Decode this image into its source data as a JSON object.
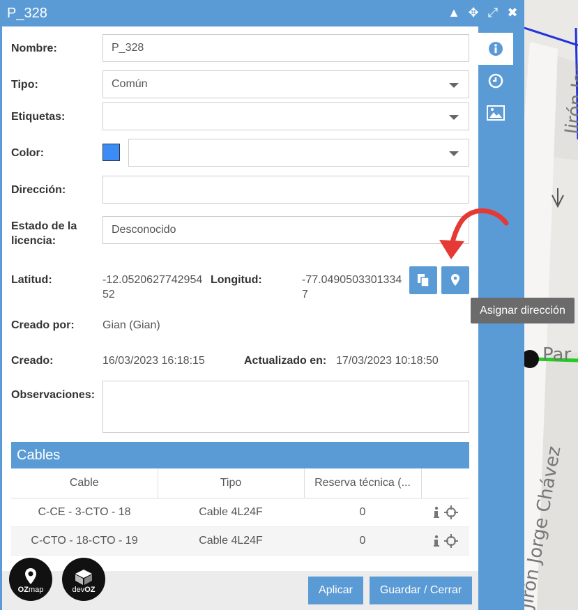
{
  "window": {
    "title": "P_328"
  },
  "form": {
    "nombre_label": "Nombre:",
    "nombre_value": "P_328",
    "tipo_label": "Tipo:",
    "tipo_value": "Común",
    "etiquetas_label": "Etiquetas:",
    "etiquetas_value": "",
    "color_label": "Color:",
    "color_value": "#3b8cf7",
    "direccion_label": "Dirección:",
    "direccion_value": "",
    "estado_label_1": "Estado de la",
    "estado_label_2": "licencia:",
    "estado_value": "Desconocido",
    "latitud_label": "Latitud:",
    "latitud_value_1": "-12.0520627742954",
    "latitud_value_2": "52",
    "longitud_label": "Longitud:",
    "longitud_value_1": "-77.0490503301334",
    "longitud_value_2": "7",
    "creado_por_label": "Creado por:",
    "creado_por_value": "Gian (Gian)",
    "creado_label": "Creado:",
    "creado_value": "16/03/2023 16:18:15",
    "actualizado_label": "Actualizado en:",
    "actualizado_value": "17/03/2023 10:18:50",
    "observaciones_label": "Observaciones:",
    "observaciones_value": ""
  },
  "tooltip": {
    "text": "Asignar dirección"
  },
  "cables": {
    "title": "Cables",
    "columns": [
      "Cable",
      "Tipo",
      "Reserva técnica (..."
    ],
    "rows": [
      {
        "cable": "C-CE - 3-CTO - 18",
        "tipo": "Cable 4L24F",
        "reserva": "0"
      },
      {
        "cable": "C-CTO - 18-CTO - 19",
        "tipo": "Cable 4L24F",
        "reserva": "0"
      }
    ]
  },
  "footer": {
    "apply_label": "Aplicar",
    "save_label": "Guardar / Cerrar"
  },
  "logos": {
    "ozmap_1": "OZ",
    "ozmap_2": "map",
    "devoz_1": "dev",
    "devoz_2": "OZ"
  },
  "map": {
    "street_1": "Jirón Jor",
    "street_2": "Jirón Jorge Chávez",
    "street_3": "Par"
  },
  "colors": {
    "accent": "#5b9bd5",
    "arrow": "#e53935",
    "swatch": "#3b8cf7"
  }
}
